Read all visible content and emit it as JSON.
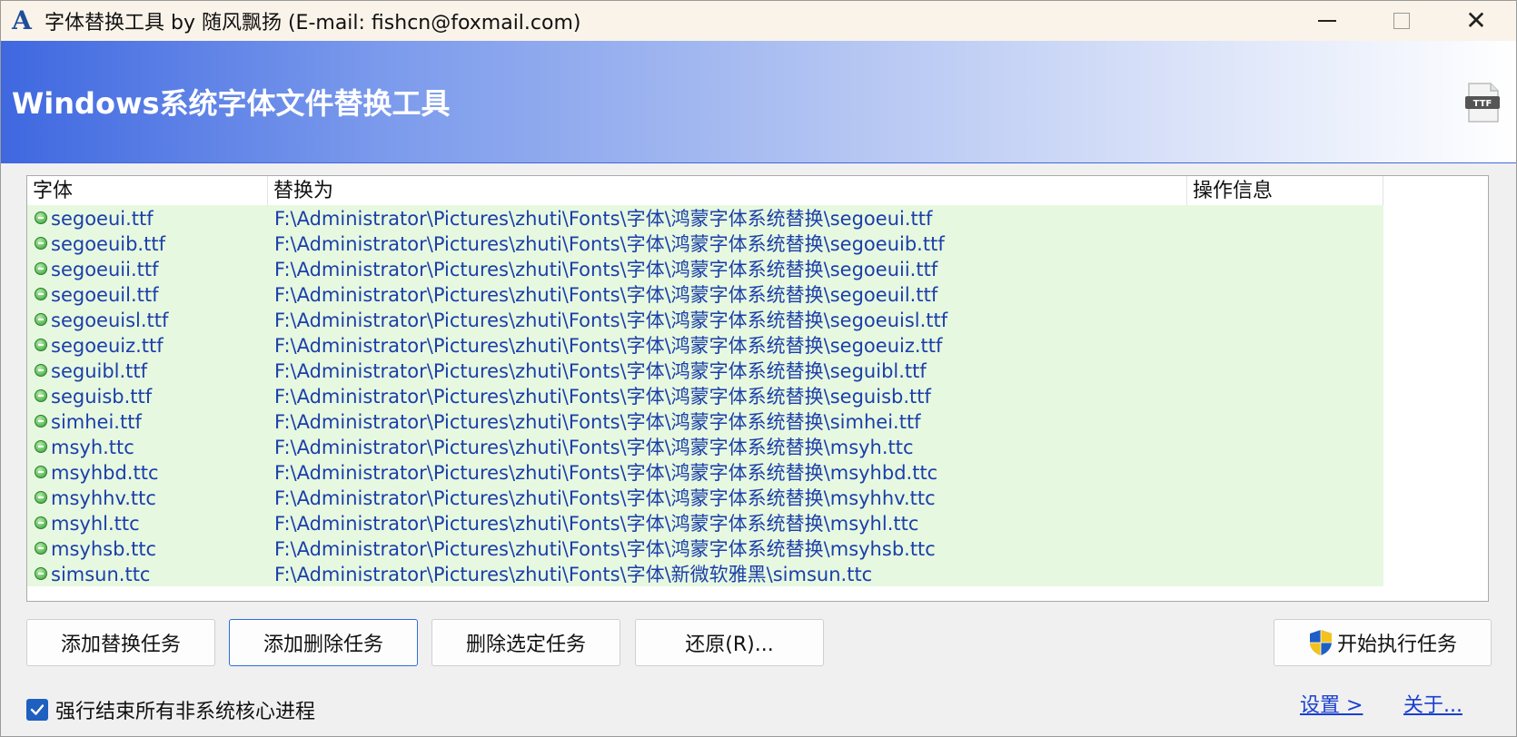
{
  "window": {
    "title": "字体替换工具 by 随风飘扬 (E-mail: fishcn@foxmail.com)",
    "app_icon_glyph": "A"
  },
  "banner": {
    "title": "Windows系统字体文件替换工具",
    "icon_text": "TTF"
  },
  "list": {
    "columns": {
      "font": "字体",
      "target": "替换为",
      "info": "操作信息"
    },
    "rows": [
      {
        "font": "segoeui.ttf",
        "target": "F:\\Administrator\\Pictures\\zhuti\\Fonts\\字体\\鸿蒙字体系统替换\\segoeui.ttf",
        "info": ""
      },
      {
        "font": "segoeuib.ttf",
        "target": "F:\\Administrator\\Pictures\\zhuti\\Fonts\\字体\\鸿蒙字体系统替换\\segoeuib.ttf",
        "info": ""
      },
      {
        "font": "segoeuii.ttf",
        "target": "F:\\Administrator\\Pictures\\zhuti\\Fonts\\字体\\鸿蒙字体系统替换\\segoeuii.ttf",
        "info": ""
      },
      {
        "font": "segoeuil.ttf",
        "target": "F:\\Administrator\\Pictures\\zhuti\\Fonts\\字体\\鸿蒙字体系统替换\\segoeuil.ttf",
        "info": ""
      },
      {
        "font": "segoeuisl.ttf",
        "target": "F:\\Administrator\\Pictures\\zhuti\\Fonts\\字体\\鸿蒙字体系统替换\\segoeuisl.ttf",
        "info": ""
      },
      {
        "font": "segoeuiz.ttf",
        "target": "F:\\Administrator\\Pictures\\zhuti\\Fonts\\字体\\鸿蒙字体系统替换\\segoeuiz.ttf",
        "info": ""
      },
      {
        "font": "seguibl.ttf",
        "target": "F:\\Administrator\\Pictures\\zhuti\\Fonts\\字体\\鸿蒙字体系统替换\\seguibl.ttf",
        "info": ""
      },
      {
        "font": "seguisb.ttf",
        "target": "F:\\Administrator\\Pictures\\zhuti\\Fonts\\字体\\鸿蒙字体系统替换\\seguisb.ttf",
        "info": ""
      },
      {
        "font": "simhei.ttf",
        "target": "F:\\Administrator\\Pictures\\zhuti\\Fonts\\字体\\鸿蒙字体系统替换\\simhei.ttf",
        "info": ""
      },
      {
        "font": "msyh.ttc",
        "target": "F:\\Administrator\\Pictures\\zhuti\\Fonts\\字体\\鸿蒙字体系统替换\\msyh.ttc",
        "info": ""
      },
      {
        "font": "msyhbd.ttc",
        "target": "F:\\Administrator\\Pictures\\zhuti\\Fonts\\字体\\鸿蒙字体系统替换\\msyhbd.ttc",
        "info": ""
      },
      {
        "font": "msyhhv.ttc",
        "target": "F:\\Administrator\\Pictures\\zhuti\\Fonts\\字体\\鸿蒙字体系统替换\\msyhhv.ttc",
        "info": ""
      },
      {
        "font": "msyhl.ttc",
        "target": "F:\\Administrator\\Pictures\\zhuti\\Fonts\\字体\\鸿蒙字体系统替换\\msyhl.ttc",
        "info": ""
      },
      {
        "font": "msyhsb.ttc",
        "target": "F:\\Administrator\\Pictures\\zhuti\\Fonts\\字体\\鸿蒙字体系统替换\\msyhsb.ttc",
        "info": ""
      },
      {
        "font": "simsun.ttc",
        "target": "F:\\Administrator\\Pictures\\zhuti\\Fonts\\字体\\新微软雅黑\\simsun.ttc",
        "info": ""
      }
    ]
  },
  "buttons": {
    "add_replace": "添加替换任务",
    "add_delete": "添加删除任务",
    "delete_selected": "删除选定任务",
    "restore": "还原(R)...",
    "start": "开始执行任务"
  },
  "options": {
    "kill_processes_label": "强行结束所有非系统核心进程",
    "kill_processes_checked": true
  },
  "links": {
    "settings": "设置 >",
    "about": "关于..."
  },
  "colors": {
    "banner_start": "#3f68e0",
    "row_background": "#e7f8e1",
    "row_text": "#1a3fa8",
    "link": "#1a3fd0",
    "checkbox": "#1f5fbf"
  }
}
